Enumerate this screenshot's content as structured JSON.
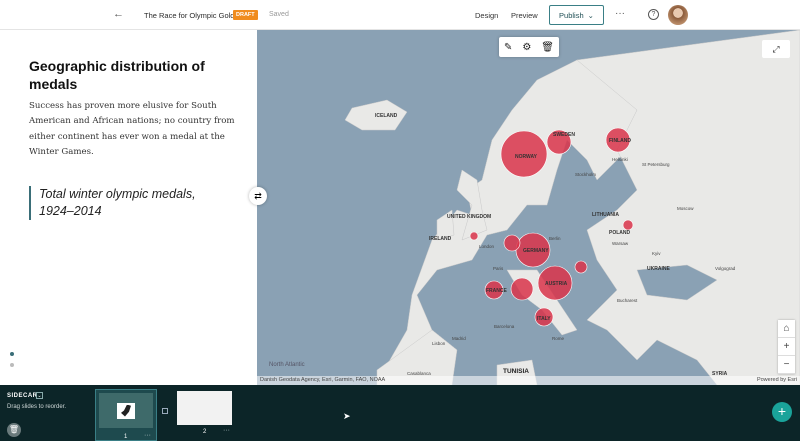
{
  "header": {
    "back_icon": "arrow-left-icon",
    "title": "The Race for Olympic Gold",
    "badge": "DRAFT",
    "status": "Saved",
    "design": "Design",
    "preview": "Preview",
    "publish": "Publish",
    "more": "···",
    "help": "?"
  },
  "sidebar": {
    "heading": "Geographic distribution of medals",
    "body": "Success has proven more elusive for South American and African nations; no country from either continent has ever won a medal at the Winter Games.",
    "quote": "Total winter olympic medals, 1924–2014"
  },
  "map": {
    "attribution": "Danish Geodata Agency, Esri, Garmin, FAO, NOAA",
    "powered": "Powered by Esri",
    "ocean": "North Atlantic",
    "bubble_color": "#d9344a",
    "labels": {
      "iceland": "ICELAND",
      "norway": "NORWAY",
      "sweden": "SWEDEN",
      "finland": "FINLAND",
      "uk": "UNITED KINGDOM",
      "ireland": "IRELAND",
      "germany": "GERMANY",
      "france": "FRANCE",
      "austria": "AUSTRIA",
      "italy": "ITALY",
      "poland": "POLAND",
      "ukraine": "UKRAINE",
      "lithuania": "LITHUANIA",
      "stockholm": "Stockholm",
      "helsinki": "Helsinki",
      "stpete": "St Petersburg",
      "moscow": "Moscow",
      "london": "London",
      "paris": "Paris",
      "berlin": "Berlin",
      "warsaw": "Warsaw",
      "kyiv": "Kyiv",
      "bucharest": "Bucharest",
      "rome": "Rome",
      "madrid": "Madrid",
      "barcelona": "Barcelona",
      "lisbon": "Lisbon",
      "volgograd": "Volgograd",
      "casablanca": "Casablanca",
      "tunisia": "TUNISIA",
      "syria": "SYRIA"
    }
  },
  "slides": {
    "section": "SIDECAR",
    "hint": "Drag slides to reorder.",
    "items": [
      {
        "num": "1",
        "more": "···"
      },
      {
        "num": "2",
        "more": "···"
      }
    ],
    "add": "+"
  }
}
